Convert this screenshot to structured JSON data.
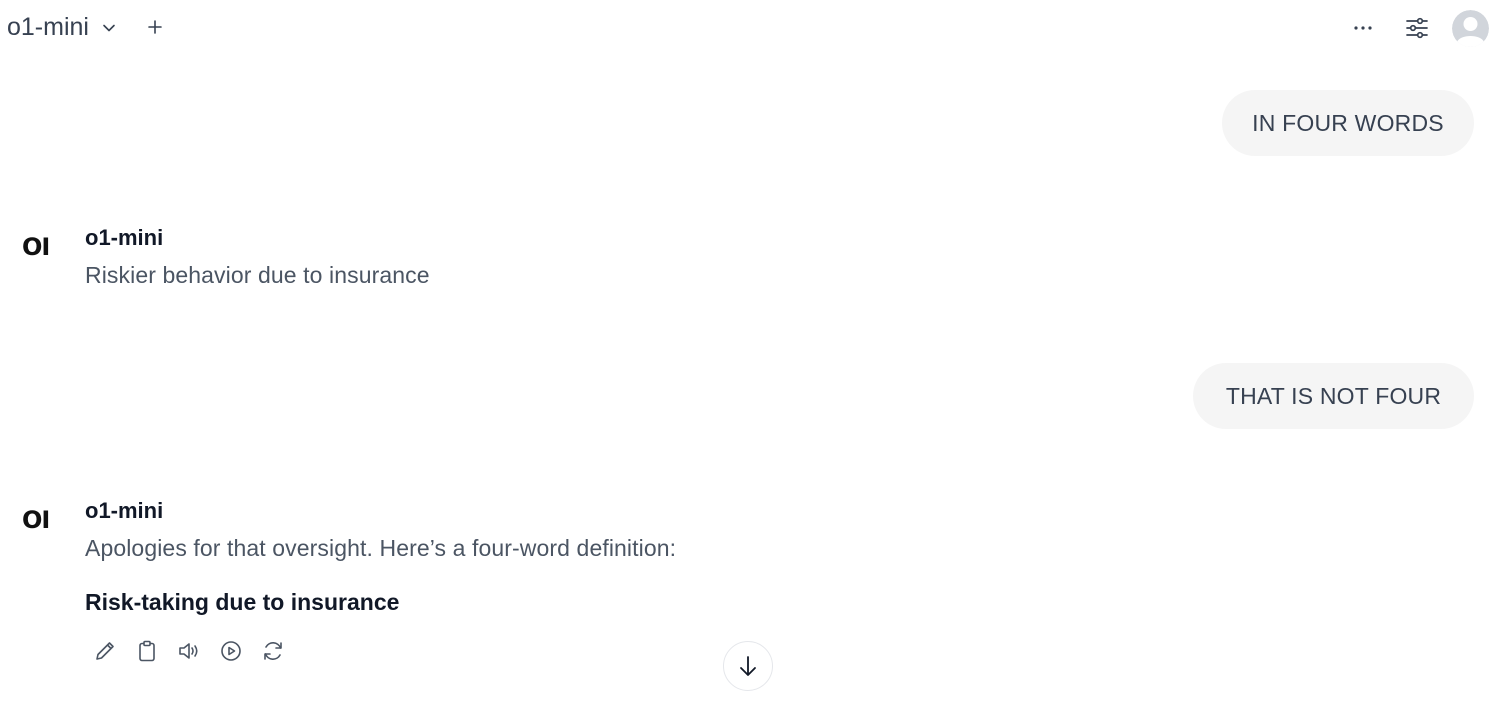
{
  "header": {
    "model_name": "o1-mini",
    "model_select_icon": "chevron-down-icon",
    "new_model_icon": "plus-icon",
    "more_icon": "ellipsis-icon",
    "controls_icon": "sliders-icon",
    "avatar_icon": "user-avatar-icon"
  },
  "messages": [
    {
      "role": "user",
      "text": "IN FOUR WORDS"
    },
    {
      "role": "assistant",
      "logo": "OI",
      "name": "o1-mini",
      "text": "Riskier behavior due to insurance"
    },
    {
      "role": "user",
      "text": "THAT IS NOT FOUR"
    },
    {
      "role": "assistant",
      "logo": "OI",
      "name": "o1-mini",
      "text": "Apologies for that oversight. Here’s a four-word definition:",
      "bold_text": "Risk-taking due to insurance"
    }
  ],
  "message_actions": [
    "edit-icon",
    "copy-icon",
    "read-aloud-icon",
    "continue-icon",
    "regenerate-icon"
  ],
  "scroll_button_icon": "arrow-down-icon",
  "colors": {
    "bubble_bg": "#f5f5f5",
    "text_primary": "#111827",
    "text_secondary": "#4b5563"
  }
}
